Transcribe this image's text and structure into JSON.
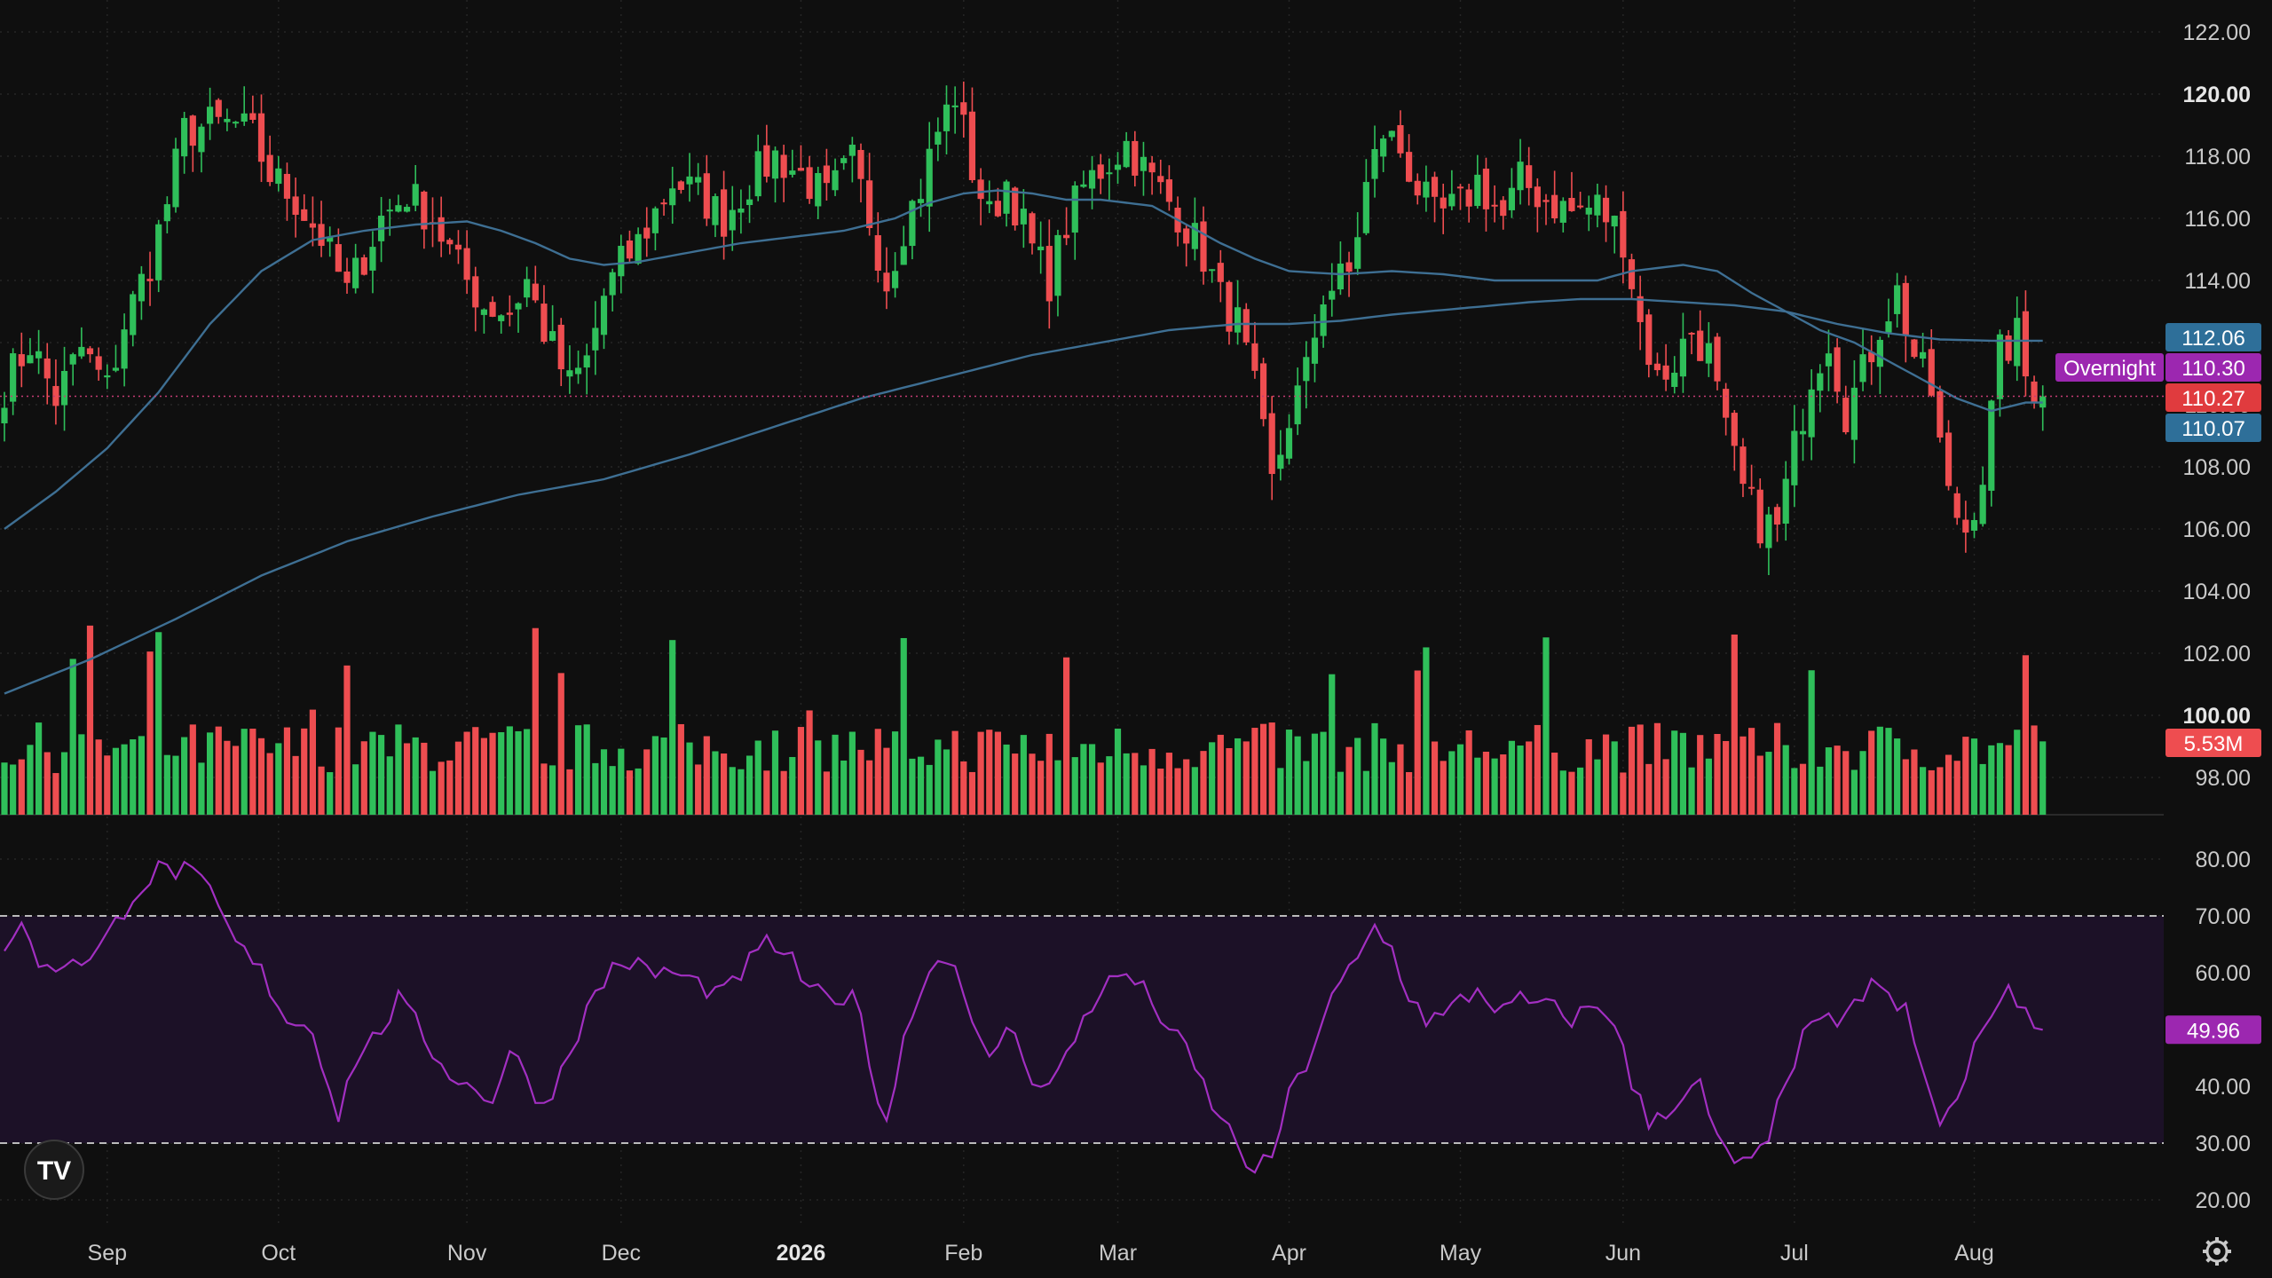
{
  "chart_data": {
    "type": "candlestick",
    "price_axis": {
      "range": [
        97,
        122.8
      ],
      "ticks": [
        "122.00",
        "120.00",
        "118.00",
        "116.00",
        "114.00",
        "112.00",
        "110.00",
        "108.00",
        "106.00",
        "104.00",
        "102.00",
        "100.00",
        "98.00"
      ],
      "bold_ticks": [
        "120.00",
        "100.00"
      ]
    },
    "rsi_axis": {
      "range": [
        17,
        83
      ],
      "ticks": [
        "80.00",
        "70.00",
        "60.00",
        "50.00",
        "40.00",
        "30.00",
        "20.00"
      ],
      "upper_band": 70,
      "lower_band": 30
    },
    "time_axis": {
      "labels": [
        {
          "text": "Sep",
          "bar": 12
        },
        {
          "text": "Oct",
          "bar": 32
        },
        {
          "text": "Nov",
          "bar": 54
        },
        {
          "text": "Dec",
          "bar": 72
        },
        {
          "text": "2026",
          "bar": 93,
          "bold": true
        },
        {
          "text": "Feb",
          "bar": 112
        },
        {
          "text": "Mar",
          "bar": 130
        },
        {
          "text": "Apr",
          "bar": 150
        },
        {
          "text": "May",
          "bar": 170
        },
        {
          "text": "Jun",
          "bar": 189
        },
        {
          "text": "Jul",
          "bar": 209
        },
        {
          "text": "Aug",
          "bar": 230
        }
      ]
    },
    "close_anchors": [
      [
        0,
        110.6
      ],
      [
        3,
        112.0
      ],
      [
        6,
        110.2
      ],
      [
        9,
        111.8
      ],
      [
        12,
        110.5
      ],
      [
        14,
        112.6
      ],
      [
        17,
        114.6
      ],
      [
        19,
        116.5
      ],
      [
        21,
        118.8
      ],
      [
        24,
        119.0
      ],
      [
        27,
        119.0
      ],
      [
        29,
        118.6
      ],
      [
        31,
        117.4
      ],
      [
        34,
        116.6
      ],
      [
        37,
        115.4
      ],
      [
        40,
        113.6
      ],
      [
        42,
        114.8
      ],
      [
        44,
        116.0
      ],
      [
        47,
        116.8
      ],
      [
        50,
        116.0
      ],
      [
        53,
        114.4
      ],
      [
        56,
        113.2
      ],
      [
        59,
        113.0
      ],
      [
        61,
        114.0
      ],
      [
        63,
        112.4
      ],
      [
        66,
        110.6
      ],
      [
        68,
        111.4
      ],
      [
        70,
        113.5
      ],
      [
        72,
        114.5
      ],
      [
        74,
        115.2
      ],
      [
        76,
        116.2
      ],
      [
        78,
        117.2
      ],
      [
        81,
        116.8
      ],
      [
        84,
        116.0
      ],
      [
        87,
        117.2
      ],
      [
        90,
        118.0
      ],
      [
        93,
        117.4
      ],
      [
        96,
        116.6
      ],
      [
        99,
        117.8
      ],
      [
        101,
        116.0
      ],
      [
        103,
        114.0
      ],
      [
        105,
        115.8
      ],
      [
        107,
        117.0
      ],
      [
        109,
        118.8
      ],
      [
        111,
        120.0
      ],
      [
        113,
        117.6
      ],
      [
        115,
        116.0
      ],
      [
        117,
        117.2
      ],
      [
        120,
        115.0
      ],
      [
        122,
        114.0
      ],
      [
        124,
        115.8
      ],
      [
        126,
        117.0
      ],
      [
        128,
        117.6
      ],
      [
        131,
        118.4
      ],
      [
        134,
        117.2
      ],
      [
        137,
        116.2
      ],
      [
        140,
        114.8
      ],
      [
        142,
        113.4
      ],
      [
        144,
        112.6
      ],
      [
        146,
        110.4
      ],
      [
        148,
        107.4
      ],
      [
        150,
        109.6
      ],
      [
        152,
        111.0
      ],
      [
        154,
        113.6
      ],
      [
        157,
        114.2
      ],
      [
        159,
        117.0
      ],
      [
        161,
        118.8
      ],
      [
        163,
        118.2
      ],
      [
        165,
        117.0
      ],
      [
        167,
        116.0
      ],
      [
        170,
        116.4
      ],
      [
        172,
        117.2
      ],
      [
        175,
        116.0
      ],
      [
        177,
        117.2
      ],
      [
        180,
        116.6
      ],
      [
        183,
        116.2
      ],
      [
        186,
        116.4
      ],
      [
        189,
        115.4
      ],
      [
        191,
        112.6
      ],
      [
        193,
        110.8
      ],
      [
        195,
        111.4
      ],
      [
        197,
        112.4
      ],
      [
        199,
        111.6
      ],
      [
        201,
        109.0
      ],
      [
        203,
        107.2
      ],
      [
        205,
        106.2
      ],
      [
        207,
        106.0
      ],
      [
        209,
        108.6
      ],
      [
        211,
        111.0
      ],
      [
        213,
        112.2
      ],
      [
        215,
        109.8
      ],
      [
        217,
        111.0
      ],
      [
        219,
        112.6
      ],
      [
        221,
        113.6
      ],
      [
        223,
        111.6
      ],
      [
        225,
        110.4
      ],
      [
        227,
        107.0
      ],
      [
        229,
        106.0
      ],
      [
        231,
        107.8
      ],
      [
        233,
        111.6
      ],
      [
        235,
        112.2
      ],
      [
        236,
        110.9
      ],
      [
        238,
        110.27
      ]
    ],
    "volume": {
      "range": [
        0,
        6.4
      ],
      "last": "5.53M"
    },
    "rsi_anchors": [
      [
        0,
        65
      ],
      [
        2,
        68
      ],
      [
        5,
        60
      ],
      [
        8,
        63
      ],
      [
        10,
        62
      ],
      [
        12,
        66
      ],
      [
        15,
        74
      ],
      [
        18,
        78
      ],
      [
        21,
        78
      ],
      [
        24,
        74
      ],
      [
        27,
        65
      ],
      [
        30,
        60
      ],
      [
        33,
        52
      ],
      [
        36,
        50
      ],
      [
        39,
        35
      ],
      [
        41,
        45
      ],
      [
        43,
        48
      ],
      [
        46,
        55
      ],
      [
        48,
        51
      ],
      [
        51,
        44
      ],
      [
        54,
        40
      ],
      [
        57,
        38
      ],
      [
        59,
        46
      ],
      [
        61,
        42
      ],
      [
        63,
        36
      ],
      [
        65,
        43
      ],
      [
        67,
        50
      ],
      [
        69,
        56
      ],
      [
        71,
        61
      ],
      [
        73,
        62
      ],
      [
        75,
        60
      ],
      [
        78,
        60
      ],
      [
        81,
        58
      ],
      [
        84,
        56
      ],
      [
        86,
        60
      ],
      [
        89,
        65
      ],
      [
        91,
        64
      ],
      [
        94,
        57
      ],
      [
        97,
        54
      ],
      [
        99,
        58
      ],
      [
        101,
        44
      ],
      [
        103,
        34
      ],
      [
        105,
        48
      ],
      [
        107,
        58
      ],
      [
        109,
        62
      ],
      [
        111,
        63
      ],
      [
        113,
        50
      ],
      [
        115,
        44
      ],
      [
        117,
        51
      ],
      [
        120,
        42
      ],
      [
        122,
        40
      ],
      [
        124,
        45
      ],
      [
        126,
        52
      ],
      [
        128,
        57
      ],
      [
        131,
        60
      ],
      [
        134,
        55
      ],
      [
        136,
        50
      ],
      [
        138,
        46
      ],
      [
        140,
        40
      ],
      [
        142,
        34
      ],
      [
        144,
        30
      ],
      [
        146,
        24
      ],
      [
        148,
        28
      ],
      [
        150,
        38
      ],
      [
        152,
        44
      ],
      [
        154,
        52
      ],
      [
        156,
        58
      ],
      [
        158,
        62
      ],
      [
        160,
        68
      ],
      [
        162,
        64
      ],
      [
        164,
        56
      ],
      [
        166,
        52
      ],
      [
        168,
        52
      ],
      [
        170,
        55
      ],
      [
        172,
        57
      ],
      [
        175,
        53
      ],
      [
        177,
        55
      ],
      [
        180,
        54
      ],
      [
        183,
        52
      ],
      [
        186,
        54
      ],
      [
        188,
        52
      ],
      [
        190,
        40
      ],
      [
        192,
        34
      ],
      [
        194,
        36
      ],
      [
        196,
        38
      ],
      [
        198,
        40
      ],
      [
        200,
        30
      ],
      [
        202,
        27
      ],
      [
        204,
        26
      ],
      [
        206,
        30
      ],
      [
        208,
        42
      ],
      [
        210,
        48
      ],
      [
        212,
        53
      ],
      [
        214,
        49
      ],
      [
        216,
        54
      ],
      [
        218,
        59
      ],
      [
        220,
        55
      ],
      [
        222,
        53
      ],
      [
        224,
        42
      ],
      [
        226,
        34
      ],
      [
        228,
        37
      ],
      [
        230,
        46
      ],
      [
        232,
        54
      ],
      [
        234,
        56
      ],
      [
        236,
        54
      ],
      [
        238,
        49.96
      ]
    ],
    "ma_short_anchors": [
      [
        0,
        106
      ],
      [
        6,
        107.2
      ],
      [
        12,
        108.6
      ],
      [
        18,
        110.4
      ],
      [
        24,
        112.6
      ],
      [
        30,
        114.3
      ],
      [
        36,
        115.3
      ],
      [
        42,
        115.6
      ],
      [
        48,
        115.8
      ],
      [
        54,
        115.9
      ],
      [
        58,
        115.6
      ],
      [
        62,
        115.2
      ],
      [
        66,
        114.7
      ],
      [
        70,
        114.5
      ],
      [
        74,
        114.6
      ],
      [
        80,
        114.9
      ],
      [
        86,
        115.2
      ],
      [
        92,
        115.4
      ],
      [
        98,
        115.6
      ],
      [
        104,
        116.0
      ],
      [
        108,
        116.5
      ],
      [
        112,
        116.8
      ],
      [
        116,
        116.9
      ],
      [
        120,
        116.8
      ],
      [
        124,
        116.6
      ],
      [
        128,
        116.6
      ],
      [
        134,
        116.4
      ],
      [
        138,
        115.8
      ],
      [
        142,
        115.2
      ],
      [
        146,
        114.7
      ],
      [
        150,
        114.3
      ],
      [
        156,
        114.2
      ],
      [
        162,
        114.3
      ],
      [
        168,
        114.2
      ],
      [
        174,
        114.0
      ],
      [
        180,
        114.0
      ],
      [
        186,
        114.0
      ],
      [
        190,
        114.3
      ],
      [
        196,
        114.5
      ],
      [
        200,
        114.3
      ],
      [
        204,
        113.6
      ],
      [
        208,
        113.0
      ],
      [
        212,
        112.4
      ],
      [
        216,
        112.0
      ],
      [
        220,
        111.4
      ],
      [
        224,
        110.8
      ],
      [
        228,
        110.2
      ],
      [
        232,
        109.8
      ],
      [
        236,
        110.07
      ],
      [
        238,
        110.07
      ]
    ],
    "ma_long_anchors": [
      [
        0,
        100.7
      ],
      [
        10,
        101.8
      ],
      [
        20,
        103.1
      ],
      [
        30,
        104.5
      ],
      [
        40,
        105.6
      ],
      [
        50,
        106.4
      ],
      [
        60,
        107.1
      ],
      [
        70,
        107.6
      ],
      [
        80,
        108.4
      ],
      [
        90,
        109.3
      ],
      [
        100,
        110.2
      ],
      [
        110,
        110.9
      ],
      [
        120,
        111.6
      ],
      [
        130,
        112.1
      ],
      [
        136,
        112.4
      ],
      [
        144,
        112.6
      ],
      [
        150,
        112.6
      ],
      [
        156,
        112.7
      ],
      [
        162,
        112.9
      ],
      [
        170,
        113.1
      ],
      [
        178,
        113.3
      ],
      [
        184,
        113.4
      ],
      [
        190,
        113.4
      ],
      [
        196,
        113.3
      ],
      [
        202,
        113.2
      ],
      [
        208,
        113.0
      ],
      [
        214,
        112.6
      ],
      [
        220,
        112.3
      ],
      [
        226,
        112.1
      ],
      [
        232,
        112.06
      ],
      [
        238,
        112.06
      ]
    ],
    "price_labels": [
      {
        "text": "112.06",
        "value": 112.06,
        "color": "#2e6f99"
      },
      {
        "text": "110.30",
        "value": 110.3,
        "color": "#9c27b0",
        "prefix": "Overnight"
      },
      {
        "text": "110.27",
        "value": 110.27,
        "color": "#e03b3e"
      },
      {
        "text": "110.07",
        "value": 110.07,
        "color": "#2e6f99"
      }
    ],
    "rsi_label": {
      "text": "49.96",
      "value": 49.96,
      "color": "#9c27b0"
    },
    "colors": {
      "up": "#2fbf5a",
      "down": "#ee4d50",
      "ma": "#3e6f93",
      "rsi": "#a22fc1",
      "rsi_band": "#1c1127",
      "grid": "#262626",
      "background": "#0f0f0f"
    }
  },
  "brand": {
    "logo_text": "TV"
  }
}
